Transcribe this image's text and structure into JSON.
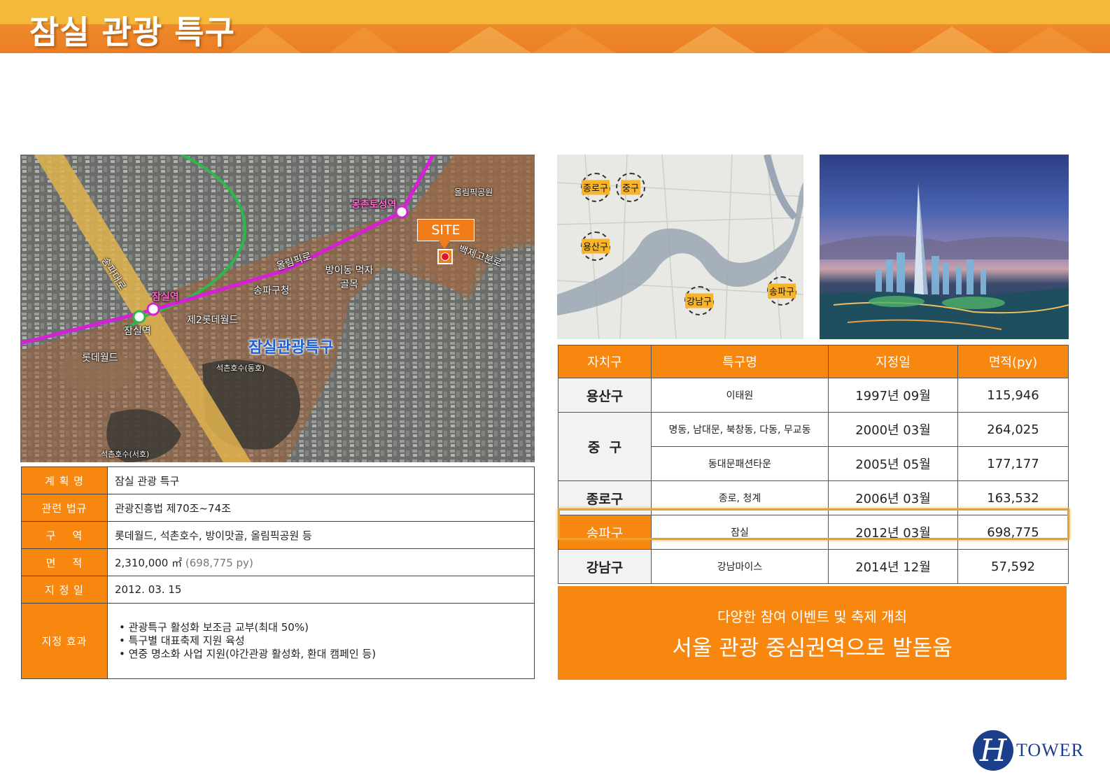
{
  "header": {
    "title": "잠실 관광 특구"
  },
  "aerial_map": {
    "site_label": "SITE",
    "zone_label": "잠실관광특구",
    "places": [
      "올림픽로",
      "방이동 먹자골목",
      "송파구청",
      "제2롯데월드",
      "롯데월드",
      "석촌호수(동호)",
      "석촌호수(서호)",
      "송파대로",
      "백제고분로",
      "올림픽공원"
    ],
    "stations": [
      "잠실역",
      "몽촌토성역"
    ],
    "line8_station": "잠실역"
  },
  "info_table": [
    {
      "key": "계 획 명",
      "value": "잠실 관광 특구"
    },
    {
      "key": "관련 법규",
      "value": "관광진흥법 제70조~74조"
    },
    {
      "key": "구    역",
      "value": "롯데월드, 석촌호수, 방이맛골, 올림픽공원 등"
    },
    {
      "key": "면    적",
      "value": "2,310,000 ㎡",
      "value_note": "(698,775 py)"
    },
    {
      "key": "지 정 일",
      "value": "2012. 03. 15"
    },
    {
      "key": "지정 효과",
      "bullets": [
        "• 관광특구 활성화 보조금 교부(최대 50%)",
        "• 특구별 대표축제 지원 육성",
        "• 연중 명소화 사업 지원(야간관광 활성화, 환대 캠페인 등)"
      ]
    }
  ],
  "seoul_map": {
    "districts": [
      "종로구",
      "중구",
      "용산구",
      "강남구",
      "송파구"
    ]
  },
  "district_table": {
    "headers": [
      "자치구",
      "특구명",
      "지정일",
      "면적(py)"
    ],
    "rows": [
      {
        "district": "용산구",
        "name": "이태원",
        "date": "1997년 09월",
        "area": "115,946"
      },
      {
        "district": "중  구",
        "name": "명동, 남대문, 북창동, 다동, 무교동",
        "date": "2000년 03월",
        "area": "264,025"
      },
      {
        "name": "동대문패션타운",
        "date": "2005년 05월",
        "area": "177,177"
      },
      {
        "district": "종로구",
        "name": "종로, 청계",
        "date": "2006년 03월",
        "area": "163,532"
      },
      {
        "district": "송파구",
        "name": "잠실",
        "date": "2012년 03월",
        "area": "698,775"
      },
      {
        "district": "강남구",
        "name": "강남마이스",
        "date": "2014년 12월",
        "area": "57,592"
      }
    ]
  },
  "banner": {
    "line1": "다양한 참여 이벤트 및 축제 개최",
    "line2": "서울 관광 중심권역으로 발돋움"
  },
  "logo": {
    "text": "TOWER",
    "mark": "H"
  },
  "colors": {
    "accent": "#f7870f",
    "header_top": "#f5b93a",
    "logo_blue": "#1c3f8c"
  }
}
